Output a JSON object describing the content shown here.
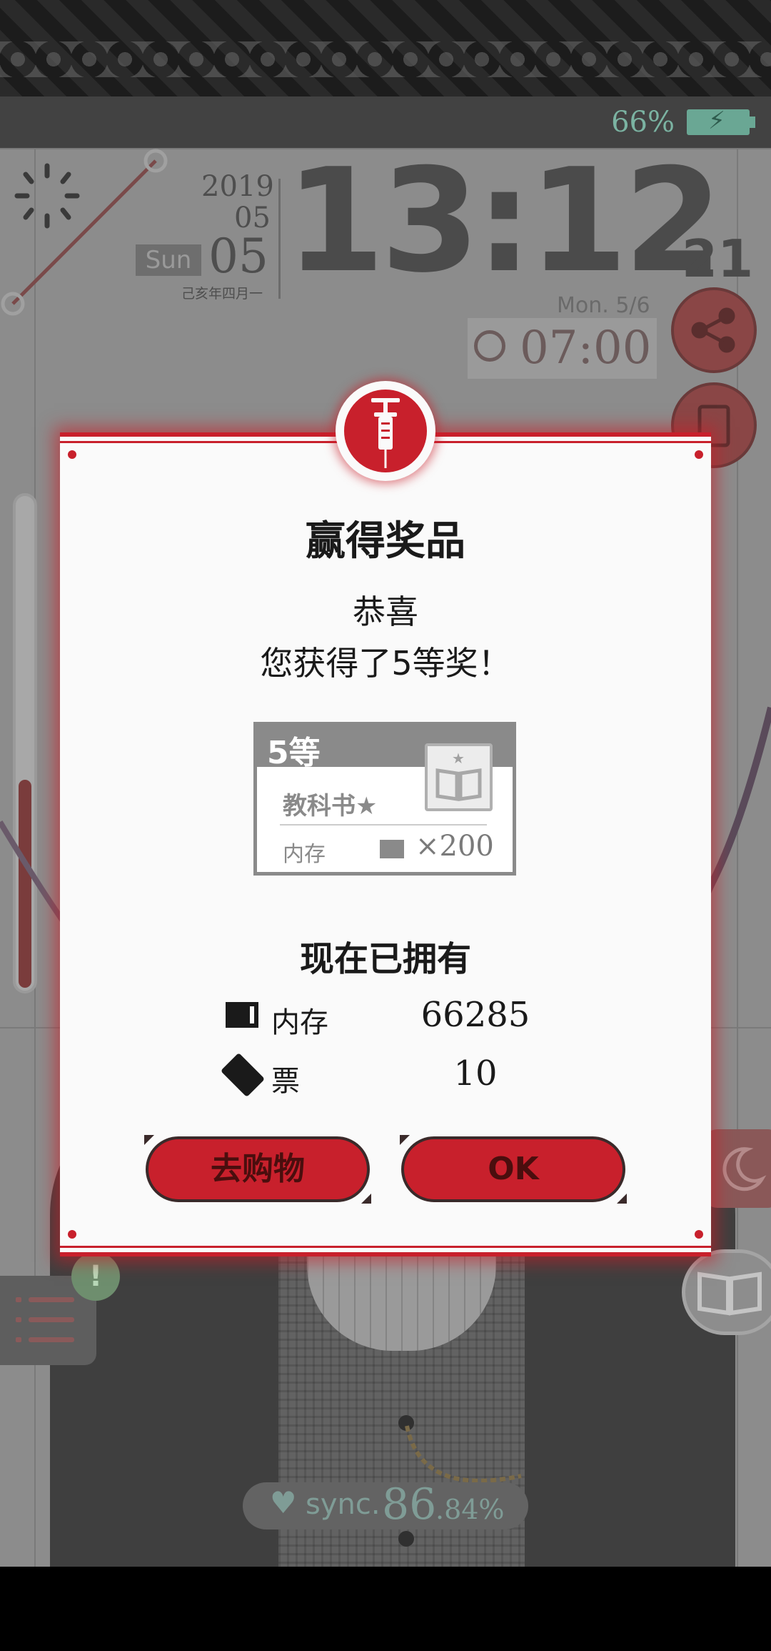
{
  "status_bar": {
    "battery_percent": "66%",
    "battery_icon": "battery-charging-icon"
  },
  "clock": {
    "year": "2019",
    "month": "05",
    "day": "05",
    "weekday": "Sun",
    "lunar_date": "己亥年四月一",
    "time": "13:12",
    "seconds": "21",
    "next_alarm_date": "Mon.  5/6",
    "alarm_time": "07:00"
  },
  "sync": {
    "label": "sync.",
    "value": "86",
    "decimal": ".84%"
  },
  "modal": {
    "title": "赢得奖品",
    "congrats": "恭喜",
    "prize_line": "您获得了5等奖！",
    "prize_card": {
      "rank": "5等",
      "item_name": "教科书★",
      "item_category": "内存",
      "quantity": "×200"
    },
    "owned_title": "现在已拥有",
    "owned": [
      {
        "icon": "memory-card-icon",
        "label": "内存",
        "value": "66285"
      },
      {
        "icon": "ticket-icon",
        "label": "票",
        "value": "10"
      }
    ],
    "buttons": {
      "shop": "去购物",
      "ok": "OK"
    }
  },
  "colors": {
    "accent_red": "#c8202c",
    "overlay_gray": "#8c8c8c",
    "sync_teal": "#7f9c96"
  },
  "gauge": {
    "level_fraction": 0.42
  }
}
